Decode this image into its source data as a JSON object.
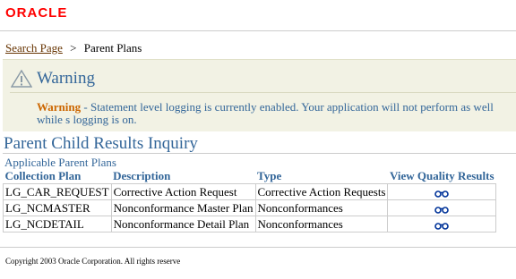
{
  "brand": {
    "logo": "ORACLE",
    "accent": "#ff0000"
  },
  "breadcrumb": {
    "link": "Search Page",
    "separator": ">",
    "current": "Parent Plans"
  },
  "warning": {
    "title": "Warning",
    "label": "Warning",
    "dash": " - ",
    "message": "Statement level logging is currently enabled. Your application will not perform as well while s logging is on.",
    "icon": "warning-triangle-icon"
  },
  "page": {
    "title": "Parent Child Results Inquiry",
    "subtitle": "Applicable Parent Plans"
  },
  "table": {
    "columns": [
      "Collection Plan",
      "Description",
      "Type",
      "View Quality Results"
    ],
    "rows": [
      {
        "plan": "LG_CAR_REQUEST",
        "description": "Corrective Action Request",
        "type": "Corrective Action Requests"
      },
      {
        "plan": "LG_NCMASTER",
        "description": "Nonconformance Master Plan",
        "type": "Nonconformances"
      },
      {
        "plan": "LG_NCDETAIL",
        "description": "Nonconformance Detail Plan",
        "type": "Nonconformances"
      }
    ],
    "view_icon": "eyeglasses-icon"
  },
  "footer": {
    "copyright": "Copyright 2003 Oracle Corporation. All rights reserve"
  },
  "colors": {
    "header_text": "#336699",
    "link": "#663300",
    "warning_label": "#cc6600",
    "warning_bg": "#f2f2e4"
  }
}
